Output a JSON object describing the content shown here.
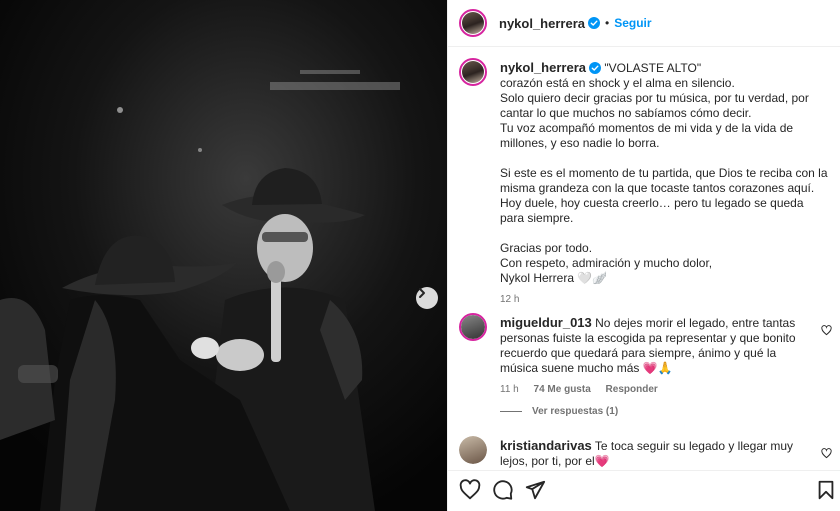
{
  "post": {
    "username": "nykol_herrera",
    "dot": "•",
    "follow_label": "Seguir",
    "caption_lines": [
      "\"VOLASTE ALTO\"",
      "corazón está en shock y el alma en silencio.",
      "Solo quiero decir gracias por tu música, por tu verdad, por cantar lo que muchos no sabíamos cómo decir.",
      "Tu voz acompañó momentos de mi vida y de la vida de millones, y eso nadie lo borra.",
      "Si este es el momento de tu partida, que Dios te reciba con la misma grandeza con la que tocaste tantos corazones aquí.",
      "Hoy duele, hoy cuesta creerlo… pero tu legado se queda para siempre.",
      "Gracias por todo.",
      "Con respeto, admiración y mucho dolor,",
      "Nykol Herrera 🤍🪽"
    ],
    "caption_time": "12 h"
  },
  "comments": [
    {
      "username": "migueldur_013",
      "text": "No dejes morir el legado, entre tantas personas fuiste la escogida pa representar y que bonito recuerdo que quedará para siempre, ánimo y qué la música suene mucho más 💗🙏",
      "time": "11 h",
      "likes": "74 Me gusta",
      "reply": "Responder",
      "view_replies": "Ver respuestas (1)"
    },
    {
      "username": "kristiandarivas",
      "text": "Te toca seguir su legado y llegar muy lejos, por ti, por el💗"
    }
  ],
  "icons": {
    "like": "heart-icon",
    "comment": "comment-icon",
    "share": "share-icon",
    "save": "bookmark-icon",
    "next": "chevron-right-icon",
    "verified": "verified-badge-icon"
  },
  "colors": {
    "accent": "#0095f6",
    "text": "#262626",
    "muted": "#737373",
    "verified": "#0095f6"
  }
}
